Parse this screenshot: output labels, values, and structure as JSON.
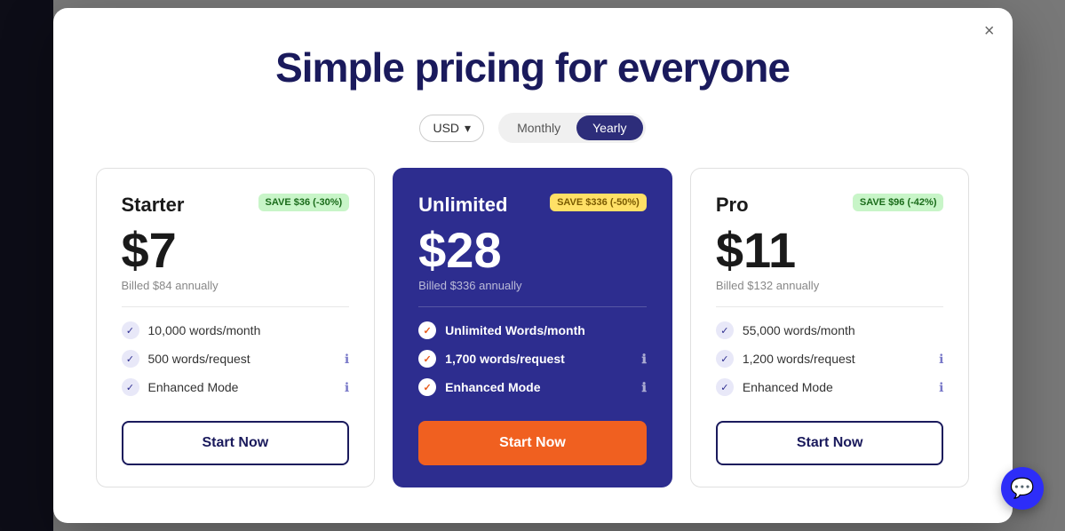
{
  "modal": {
    "title": "Simple pricing for everyone",
    "close_label": "×"
  },
  "controls": {
    "currency": {
      "value": "USD",
      "dropdown_icon": "▾"
    },
    "billing": {
      "options": [
        "Monthly",
        "Yearly"
      ],
      "active": "Yearly"
    }
  },
  "plans": [
    {
      "id": "starter",
      "name": "Starter",
      "save_badge": "SAVE $36 (-30%)",
      "save_badge_type": "green",
      "price": "$7",
      "billing": "Billed $84 annually",
      "features": [
        {
          "text": "10,000 words/month",
          "bold": false
        },
        {
          "text": "500 words/request",
          "bold": false,
          "info": true
        },
        {
          "text": "Enhanced Mode",
          "bold": false,
          "info": true
        }
      ],
      "cta": "Start Now",
      "featured": false
    },
    {
      "id": "unlimited",
      "name": "Unlimited",
      "save_badge": "SAVE $336 (-50%)",
      "save_badge_type": "yellow",
      "price": "$28",
      "billing": "Billed $336 annually",
      "features": [
        {
          "text": "Unlimited Words/month",
          "bold": true
        },
        {
          "text": "1,700 words/request",
          "bold": false,
          "info": true
        },
        {
          "text": "Enhanced Mode",
          "bold": false,
          "info": true
        }
      ],
      "cta": "Start Now",
      "featured": true
    },
    {
      "id": "pro",
      "name": "Pro",
      "save_badge": "SAVE $96 (-42%)",
      "save_badge_type": "green",
      "price": "$11",
      "billing": "Billed $132 annually",
      "features": [
        {
          "text": "55,000 words/month",
          "bold": false
        },
        {
          "text": "1,200 words/request",
          "bold": false,
          "info": true
        },
        {
          "text": "Enhanced Mode",
          "bold": false,
          "info": true
        }
      ],
      "cta": "Start Now",
      "featured": false
    }
  ],
  "chat": {
    "icon": "💬"
  }
}
